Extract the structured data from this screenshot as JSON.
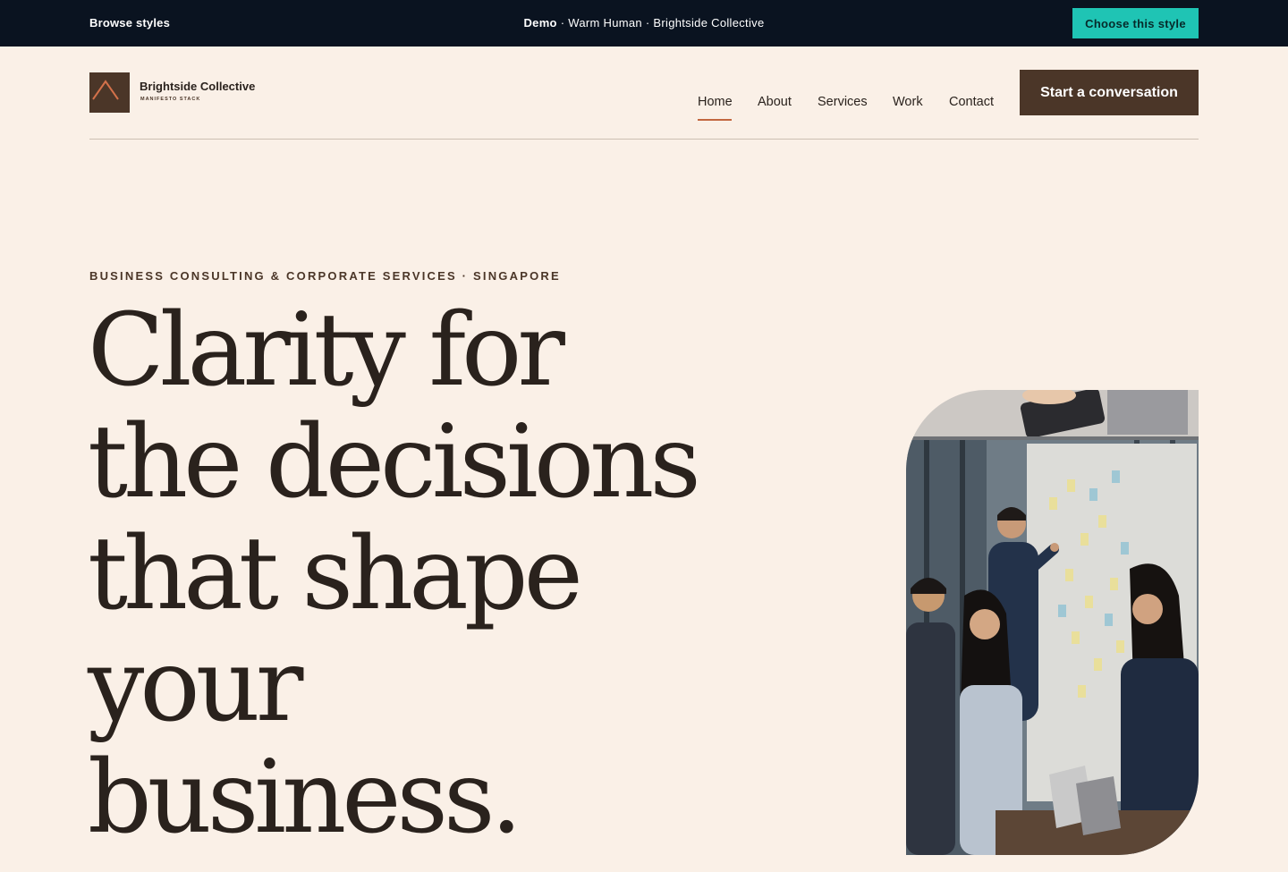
{
  "demo_bar": {
    "browse_label": "Browse styles",
    "demo_label": "Demo",
    "demo_info": " · Warm Human · Brightside Collective",
    "choose_label": "Choose this style"
  },
  "header": {
    "brand_name": "Brightside Collective",
    "brand_tagline": "MANIFESTO STACK",
    "nav": [
      "Home",
      "About",
      "Services",
      "Work",
      "Contact"
    ],
    "active_nav": "Home",
    "cta_label": "Start a conversation"
  },
  "hero": {
    "eyebrow": "BUSINESS CONSULTING & CORPORATE SERVICES · SINGAPORE",
    "headline_lines": [
      "Clarity for",
      "the decisions",
      "that shape",
      "your",
      "business."
    ]
  },
  "colors": {
    "page_bg": "#faf0e7",
    "demo_bar_bg": "#0a1320",
    "accent_teal": "#1fc4b4",
    "brand_brown": "#4b3628",
    "accent_orange": "#c2673f",
    "text_dark": "#2a221d"
  },
  "icons": {
    "logo": "roof-chevron-icon"
  }
}
